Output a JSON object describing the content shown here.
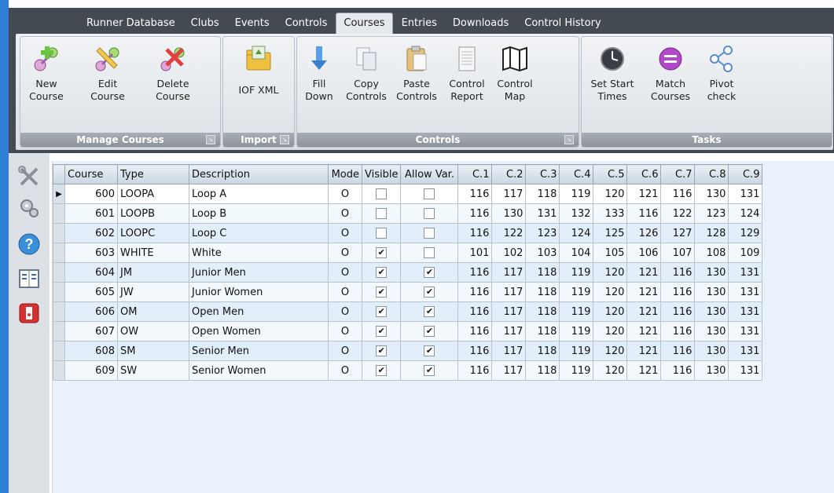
{
  "tabs": [
    {
      "label": "Runner Database",
      "active": false
    },
    {
      "label": "Clubs",
      "active": false
    },
    {
      "label": "Events",
      "active": false
    },
    {
      "label": "Controls",
      "active": false
    },
    {
      "label": "Courses",
      "active": true
    },
    {
      "label": "Entries",
      "active": false
    },
    {
      "label": "Downloads",
      "active": false
    },
    {
      "label": "Control History",
      "active": false
    }
  ],
  "ribbon": {
    "groups": {
      "manage": "Manage Courses",
      "import": "Import",
      "controls": "Controls",
      "tasks": "Tasks"
    },
    "buttons": {
      "new_course": "New\nCourse",
      "edit_course": "Edit\nCourse",
      "delete_course": "Delete\nCourse",
      "iof_xml": "IOF XML",
      "fill_down": "Fill\nDown",
      "copy_controls": "Copy\nControls",
      "paste_controls": "Paste\nControls",
      "control_report": "Control\nReport",
      "control_map": "Control\nMap",
      "set_start_times": "Set Start\nTimes",
      "match_courses": "Match\nCourses",
      "pivot_check": "Pivot\ncheck"
    }
  },
  "grid": {
    "columns": [
      "Course",
      "Type",
      "Description",
      "Mode",
      "Visible",
      "Allow Var.",
      "C.1",
      "C.2",
      "C.3",
      "C.4",
      "C.5",
      "C.6",
      "C.7",
      "C.8",
      "C.9"
    ],
    "rows": [
      {
        "course": "600",
        "type": "LOOPA",
        "description": "Loop A",
        "mode": "O",
        "visible": false,
        "allow_var": false,
        "controls": [
          "116",
          "117",
          "118",
          "119",
          "120",
          "121",
          "116",
          "130",
          "131"
        ]
      },
      {
        "course": "601",
        "type": "LOOPB",
        "description": "Loop B",
        "mode": "O",
        "visible": false,
        "allow_var": false,
        "controls": [
          "116",
          "130",
          "131",
          "132",
          "133",
          "116",
          "122",
          "123",
          "124"
        ]
      },
      {
        "course": "602",
        "type": "LOOPC",
        "description": "Loop C",
        "mode": "O",
        "visible": false,
        "allow_var": false,
        "controls": [
          "116",
          "122",
          "123",
          "124",
          "125",
          "126",
          "127",
          "128",
          "129"
        ]
      },
      {
        "course": "603",
        "type": "WHITE",
        "description": "White",
        "mode": "O",
        "visible": true,
        "allow_var": false,
        "controls": [
          "101",
          "102",
          "103",
          "104",
          "105",
          "106",
          "107",
          "108",
          "109"
        ]
      },
      {
        "course": "604",
        "type": "JM",
        "description": "Junior Men",
        "mode": "O",
        "visible": true,
        "allow_var": true,
        "controls": [
          "116",
          "117",
          "118",
          "119",
          "120",
          "121",
          "116",
          "130",
          "131"
        ]
      },
      {
        "course": "605",
        "type": "JW",
        "description": "Junior Women",
        "mode": "O",
        "visible": true,
        "allow_var": true,
        "controls": [
          "116",
          "117",
          "118",
          "119",
          "120",
          "121",
          "116",
          "130",
          "131"
        ]
      },
      {
        "course": "606",
        "type": "OM",
        "description": "Open Men",
        "mode": "O",
        "visible": true,
        "allow_var": true,
        "controls": [
          "116",
          "117",
          "118",
          "119",
          "120",
          "121",
          "116",
          "130",
          "131"
        ]
      },
      {
        "course": "607",
        "type": "OW",
        "description": "Open Women",
        "mode": "O",
        "visible": true,
        "allow_var": true,
        "controls": [
          "116",
          "117",
          "118",
          "119",
          "120",
          "121",
          "116",
          "130",
          "131"
        ]
      },
      {
        "course": "608",
        "type": "SM",
        "description": "Senior Men",
        "mode": "O",
        "visible": true,
        "allow_var": true,
        "controls": [
          "116",
          "117",
          "118",
          "119",
          "120",
          "121",
          "116",
          "130",
          "131"
        ]
      },
      {
        "course": "609",
        "type": "SW",
        "description": "Senior Women",
        "mode": "O",
        "visible": true,
        "allow_var": true,
        "controls": [
          "116",
          "117",
          "118",
          "119",
          "120",
          "121",
          "116",
          "130",
          "131"
        ]
      }
    ]
  },
  "side_icons": [
    "tools-icon",
    "settings-gear-icon",
    "help-icon",
    "report-icon",
    "exit-icon"
  ]
}
